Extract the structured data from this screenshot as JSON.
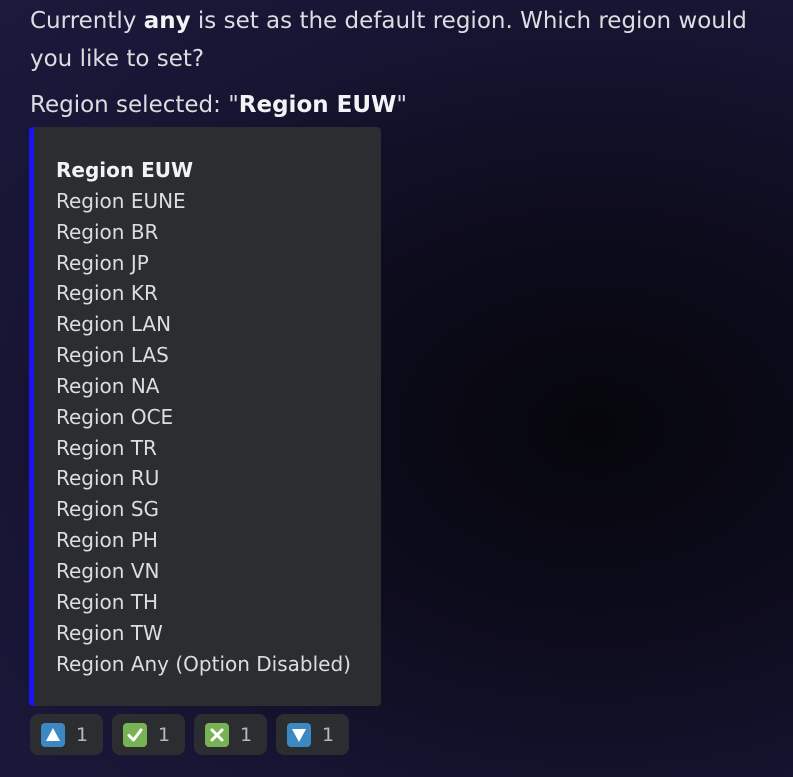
{
  "message": {
    "prefix": "Currently ",
    "current_region": "any",
    "suffix": " is set as the default region. Which region would you like to set?"
  },
  "selection": {
    "label_prefix": "Region selected: \"",
    "value": "Region EUW",
    "label_suffix": "\""
  },
  "embed": {
    "accent_color": "#1a14f0",
    "regions": [
      "Region EUW",
      "Region EUNE",
      "Region BR",
      "Region JP",
      "Region KR",
      "Region LAN",
      "Region LAS",
      "Region NA",
      "Region OCE",
      "Region TR",
      "Region RU",
      "Region SG",
      "Region PH",
      "Region VN",
      "Region TH",
      "Region TW",
      "Region Any (Option Disabled)"
    ]
  },
  "reactions": [
    {
      "icon": "arrow-up-icon",
      "count": "1",
      "color": "#3b88c3"
    },
    {
      "icon": "check-mark-icon",
      "count": "1",
      "color": "#77b255"
    },
    {
      "icon": "cross-mark-icon",
      "count": "1",
      "color": "#77b255"
    },
    {
      "icon": "arrow-down-icon",
      "count": "1",
      "color": "#3b88c3"
    }
  ]
}
